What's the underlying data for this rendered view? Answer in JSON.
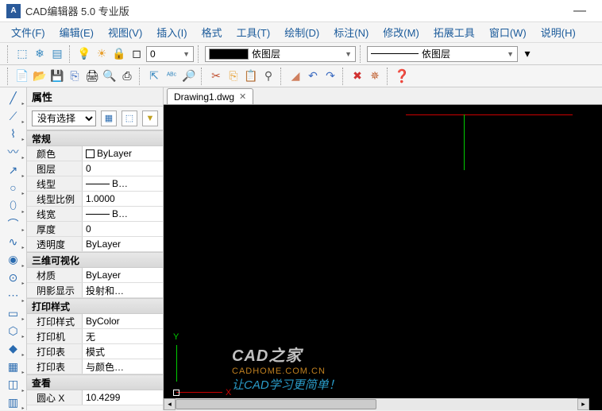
{
  "title": "CAD编辑器 5.0 专业版",
  "menus": [
    "文件(F)",
    "编辑(E)",
    "视图(V)",
    "插入(I)",
    "格式",
    "工具(T)",
    "绘制(D)",
    "标注(N)",
    "修改(M)",
    "拓展工具",
    "窗口(W)",
    "说明(H)"
  ],
  "layer_row": {
    "zero": "0",
    "bylayer1": "依图层",
    "bylayer2": "依图层"
  },
  "properties": {
    "header": "属性",
    "selector": "没有选择",
    "sections": {
      "general": {
        "title": "常规",
        "rows": [
          {
            "label": "颜色",
            "value": "ByLayer",
            "swatch": true
          },
          {
            "label": "图层",
            "value": "0"
          },
          {
            "label": "线型",
            "value": "B…",
            "line": true
          },
          {
            "label": "线型比例",
            "value": "1.0000"
          },
          {
            "label": "线宽",
            "value": "B…",
            "line": true
          },
          {
            "label": "厚度",
            "value": "0"
          },
          {
            "label": "透明度",
            "value": "ByLayer"
          }
        ]
      },
      "visual": {
        "title": "三维可视化",
        "rows": [
          {
            "label": "材质",
            "value": "ByLayer"
          },
          {
            "label": "阴影显示",
            "value": "投射和…"
          }
        ]
      },
      "print": {
        "title": "打印样式",
        "rows": [
          {
            "label": "打印样式",
            "value": "ByColor"
          },
          {
            "label": "打印机",
            "value": "无"
          },
          {
            "label": "打印表",
            "value": "模式"
          },
          {
            "label": "打印表",
            "value": "与颜色…"
          }
        ]
      },
      "view": {
        "title": "查看",
        "rows": [
          {
            "label": "圆心 X",
            "value": "10.4299"
          }
        ]
      }
    }
  },
  "tab": {
    "name": "Drawing1.dwg"
  },
  "axes": {
    "x": "X",
    "y": "Y"
  },
  "watermark": {
    "l1a": "CAD",
    "l1b": "之家",
    "l2": "CADHOME.COM.CN",
    "l3": "让CAD学习更简单！"
  }
}
